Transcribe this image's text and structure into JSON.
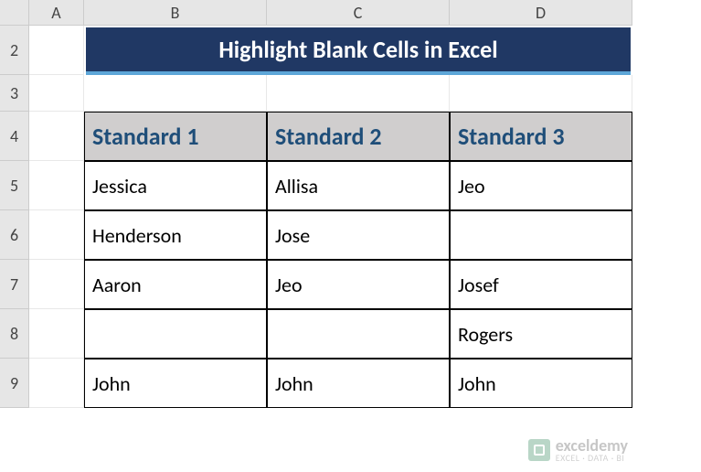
{
  "columns": [
    "A",
    "B",
    "C",
    "D"
  ],
  "rows": [
    "2",
    "3",
    "4",
    "5",
    "6",
    "7",
    "8",
    "9"
  ],
  "title": "Highlight Blank Cells in Excel",
  "table": {
    "headers": [
      "Standard 1",
      "Standard 2",
      "Standard 3"
    ],
    "data": [
      [
        "Jessica",
        "Allisa",
        "Jeo"
      ],
      [
        "Henderson",
        "Jose",
        ""
      ],
      [
        "Aaron",
        "Jeo",
        "Josef"
      ],
      [
        "",
        "",
        "Rogers"
      ],
      [
        "John",
        "John",
        "John"
      ]
    ]
  },
  "watermark": {
    "main": "exceldemy",
    "sub": "EXCEL · DATA · BI"
  },
  "chart_data": {
    "type": "table",
    "title": "Highlight Blank Cells in Excel",
    "columns": [
      "Standard 1",
      "Standard 2",
      "Standard 3"
    ],
    "rows": [
      {
        "Standard 1": "Jessica",
        "Standard 2": "Allisa",
        "Standard 3": "Jeo"
      },
      {
        "Standard 1": "Henderson",
        "Standard 2": "Jose",
        "Standard 3": ""
      },
      {
        "Standard 1": "Aaron",
        "Standard 2": "Jeo",
        "Standard 3": "Josef"
      },
      {
        "Standard 1": "",
        "Standard 2": "",
        "Standard 3": "Rogers"
      },
      {
        "Standard 1": "John",
        "Standard 2": "John",
        "Standard 3": "John"
      }
    ]
  }
}
